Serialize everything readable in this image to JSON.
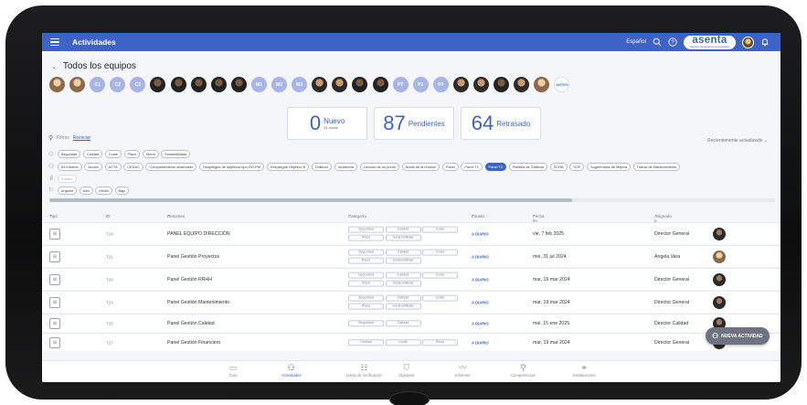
{
  "header": {
    "title": "Actividades",
    "language": "Español",
    "brand": "asenta",
    "brand_tagline": "Gestión de Equipos Conectados",
    "accent": "#3d63c6"
  },
  "team": {
    "title": "Todos los equipos",
    "avatars": [
      {
        "type": "photo",
        "tone": "light"
      },
      {
        "type": "photo",
        "tone": "light"
      },
      {
        "type": "initials",
        "text": "C1"
      },
      {
        "type": "initials",
        "text": "C2"
      },
      {
        "type": "initials",
        "text": "C3"
      },
      {
        "type": "photo",
        "tone": "dark"
      },
      {
        "type": "photo",
        "tone": "dark"
      },
      {
        "type": "photo",
        "tone": "dark"
      },
      {
        "type": "photo",
        "tone": "dark"
      },
      {
        "type": "photo",
        "tone": "dark"
      },
      {
        "type": "initials",
        "text": "M1"
      },
      {
        "type": "initials",
        "text": "M2"
      },
      {
        "type": "initials",
        "text": "M3"
      },
      {
        "type": "photo",
        "tone": "normal"
      },
      {
        "type": "photo",
        "tone": "normal"
      },
      {
        "type": "photo",
        "tone": "dark"
      },
      {
        "type": "photo",
        "tone": "dark"
      },
      {
        "type": "initials",
        "text": "PT"
      },
      {
        "type": "initials",
        "text": "P2"
      },
      {
        "type": "initials",
        "text": "P3"
      },
      {
        "type": "photo",
        "tone": "normal"
      },
      {
        "type": "photo",
        "tone": "normal"
      },
      {
        "type": "photo",
        "tone": "dark"
      },
      {
        "type": "photo",
        "tone": "normal"
      },
      {
        "type": "photo",
        "tone": "light"
      },
      {
        "type": "logo",
        "text": "ANTES"
      }
    ]
  },
  "kpis": [
    {
      "value": "0",
      "label": "Nuevo",
      "sub": "24 horas"
    },
    {
      "value": "87",
      "label": "Pendientes",
      "sub": ""
    },
    {
      "value": "64",
      "label": "Retrasado",
      "sub": ""
    }
  ],
  "filters": {
    "label": "Filtros",
    "reset": "Reiniciar",
    "sort": "Recientemente actualizado",
    "categories": [
      "Seguridad",
      "Calidad",
      "Coste",
      "Plazo",
      "Moral",
      "Sostenibilidad"
    ],
    "types": [
      "A3 Informe",
      "Acción",
      "ACTA",
      "CEDAC",
      "Comportamiento observado",
      "Despliegue de objetivos tipo OO-PM",
      "Despliegue Objetivo B",
      "Gráficos",
      "Incidencia",
      "Lección de un punto",
      "Notas de la reunión",
      "Panel",
      "Panel T1",
      "Panel T2",
      "Plantilla de Gráficos",
      "SCRA",
      "SOP",
      "Sugerencias de Mejora",
      "Tareas de Mantenimiento"
    ],
    "types_active": "Panel T2",
    "frequency": [
      "A diario"
    ],
    "priority": [
      "Urgente",
      "Alto",
      "Medio",
      "Bajo"
    ]
  },
  "table": {
    "columns": [
      "Tipo",
      "ID",
      "Resumen",
      "Categoría",
      "Estado",
      "Fecha lm",
      "Asignado a"
    ],
    "rows": [
      {
        "id": "T24",
        "resumen": "PANEL EQUIPO DIRECCIÓN",
        "cats": [
          "Seguridad",
          "Calidad",
          "Coste",
          "Plazo",
          "Sostenibilidad"
        ],
        "estado": "A DIARIO",
        "fecha": "vie, 7 feb 2025",
        "asignado": "Director General",
        "tone": "dark"
      },
      {
        "id": "T21",
        "resumen": "Panel Gestión Proyectos",
        "cats": [
          "Seguridad",
          "Calidad",
          "Coste",
          "Plazo",
          "Sostenibilidad"
        ],
        "estado": "A DIARIO",
        "fecha": "mié, 31 jul 2024",
        "asignado": "Angela Vara",
        "tone": "light"
      },
      {
        "id": "T24",
        "resumen": "Panel Gestión RRHH",
        "cats": [
          "Seguridad",
          "Calidad",
          "Coste",
          "Plazo",
          "Sostenibilidad"
        ],
        "estado": "A DIARIO",
        "fecha": "mar, 19 mar 2024",
        "asignado": "Director General",
        "tone": "dark"
      },
      {
        "id": "T24",
        "resumen": "Panel Gestión Mantenimiento",
        "cats": [
          "Seguridad",
          "Calidad",
          "Coste",
          "Plazo",
          "Sostenibilidad"
        ],
        "estado": "A DIARIO",
        "fecha": "mar, 19 mar 2024",
        "asignado": "Director General",
        "tone": "dark"
      },
      {
        "id": "T25",
        "resumen": "Panel Gestión Calidad",
        "cats": [
          "Seguridad",
          "Calidad"
        ],
        "estado": "A DIARIO",
        "fecha": "mié, 15 ene 2025",
        "asignado": "Director Calidad",
        "tone": "dark"
      },
      {
        "id": "T27",
        "resumen": "Panel Gestión Financiero",
        "cats": [
          "Calidad",
          "Coste",
          "Plazo"
        ],
        "estado": "A DIARIO",
        "fecha": "mar, 19 mar 2024",
        "asignado": "Director General",
        "tone": "dark"
      }
    ]
  },
  "fab_label": "NUEVA ACTIVIDAD",
  "bottom_nav": [
    {
      "label": "Guía",
      "icon": "guide-icon",
      "glyph": "▭"
    },
    {
      "label": "Actividades",
      "icon": "activities-icon",
      "glyph": "⚇",
      "active": true
    },
    {
      "label": "Listas de verificación",
      "icon": "checklist-icon",
      "glyph": "☷"
    },
    {
      "label": "Objetivos",
      "icon": "objectives-icon",
      "glyph": "⛉"
    },
    {
      "label": "Informes",
      "icon": "reports-icon",
      "glyph": "〰"
    },
    {
      "label": "Competencias",
      "icon": "skills-icon",
      "glyph": "⚲"
    },
    {
      "label": "Instalaciones",
      "icon": "facilities-icon",
      "glyph": "⚭"
    }
  ]
}
